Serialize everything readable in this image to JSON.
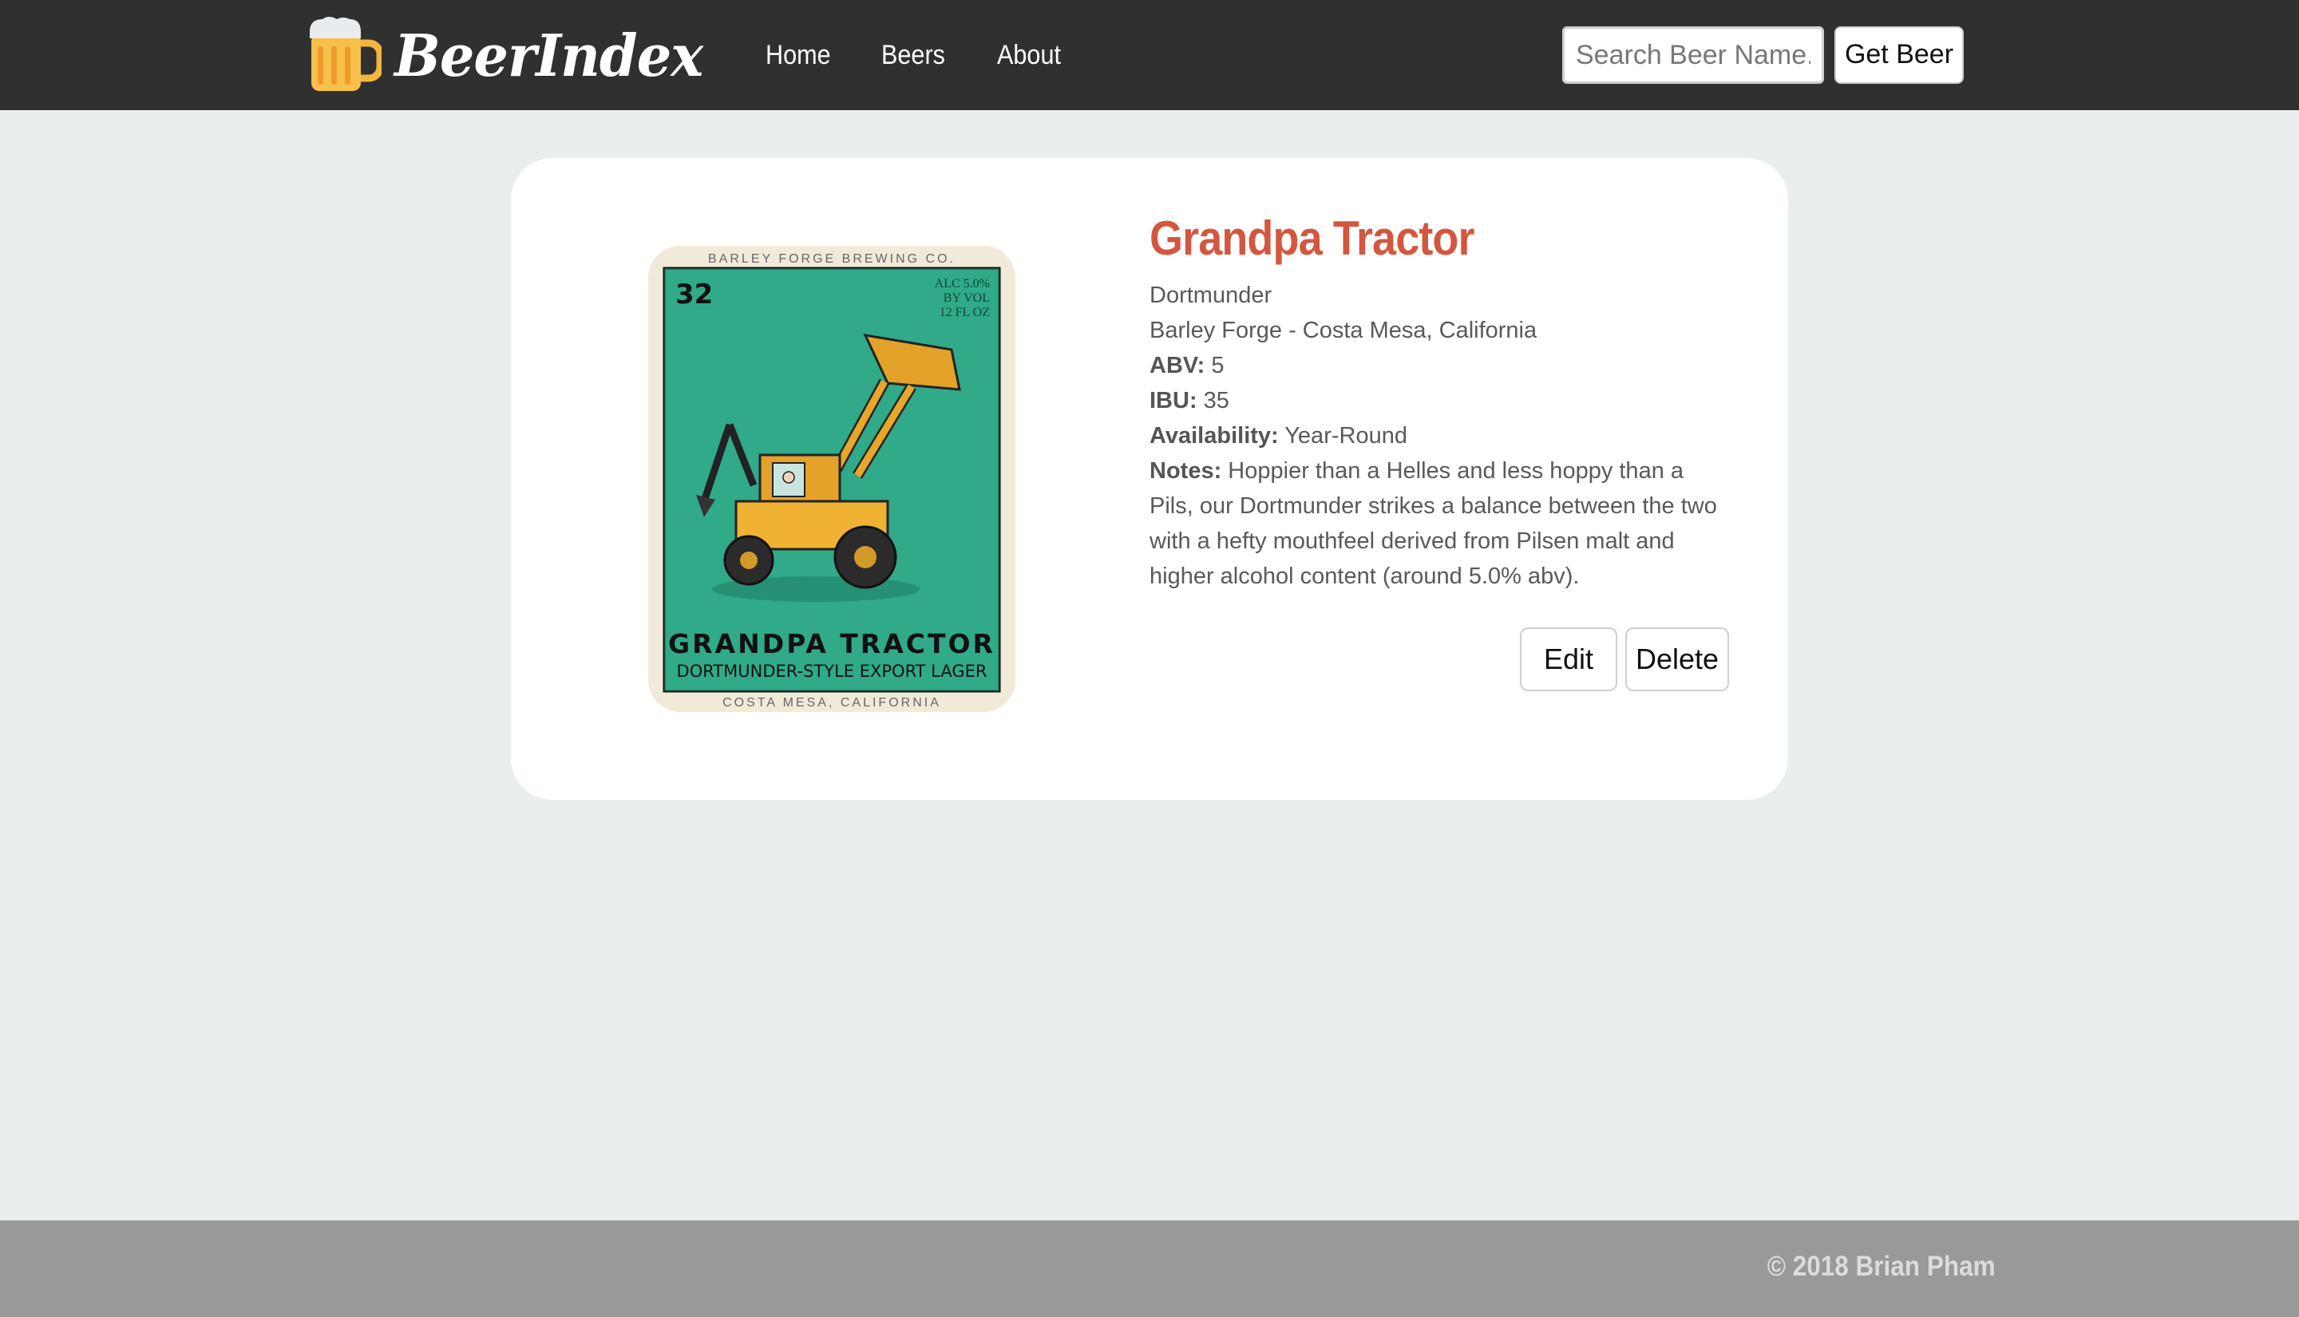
{
  "navbar": {
    "brand": "BeerIndex",
    "links": [
      {
        "label": "Home"
      },
      {
        "label": "Beers"
      },
      {
        "label": "About"
      }
    ],
    "search": {
      "placeholder": "Search Beer Name..."
    },
    "search_button": "Get Beer"
  },
  "beer": {
    "name": "Grandpa Tractor",
    "style": "Dortmunder",
    "brewery": "Barley Forge - Costa Mesa, California",
    "abv_label": "ABV:",
    "abv": "5",
    "ibu_label": "IBU:",
    "ibu": "35",
    "availability_label": "Availability:",
    "availability": "Year-Round",
    "notes_label": "Notes:",
    "notes": "Hoppier than a Helles and less hoppy than a Pils, our Dortmunder strikes a balance between the two with a hefty mouthfeel derived from Pilsen malt and higher alcohol content (around 5.0% abv).",
    "label_image": {
      "top_text": "BARLEY FORGE BREWING CO.",
      "number": "32",
      "alc_lines": [
        "ALC 5.0%",
        "BY VOL",
        "12 FL OZ"
      ],
      "title": "GRANDPA TRACTOR",
      "subtitle": "DORTMUNDER-STYLE EXPORT LAGER",
      "bottom_text": "COSTA MESA, CALIFORNIA"
    },
    "actions": {
      "edit": "Edit",
      "delete": "Delete"
    }
  },
  "footer": {
    "copyright": "© 2018 Brian Pham"
  }
}
